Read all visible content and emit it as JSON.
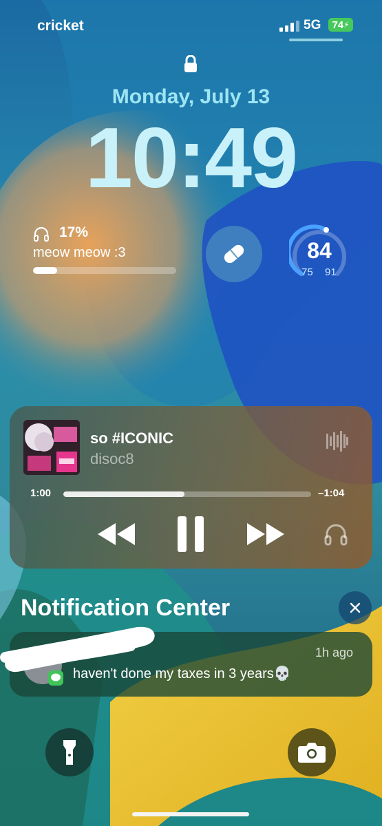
{
  "status_bar": {
    "carrier": "cricket",
    "network": "5G",
    "battery": "74"
  },
  "lock_screen": {
    "date": "Monday, July 13",
    "time": "10:49"
  },
  "widgets": {
    "device_battery": {
      "percent": "17%",
      "name": "meow meow :3",
      "level": 0.17
    },
    "gauge": {
      "value": "84",
      "low": "75",
      "high": "91"
    },
    "pill_icon": "pill-icon"
  },
  "now_playing": {
    "title": "so #ICONIC",
    "artist": "disoc8",
    "elapsed": "1:00",
    "remaining": "–1:04",
    "progress": 0.49
  },
  "notification_center": {
    "title": "Notification Center",
    "notifications": [
      {
        "time": "1h ago",
        "body": "haven't done my taxes in 3 years💀"
      }
    ]
  },
  "colors": {
    "battery_green": "#46c95c",
    "date_text": "#9ee5f3"
  },
  "icons": [
    "lock-icon",
    "headphones-icon",
    "pill-icon",
    "waveform-icon",
    "rewind-icon",
    "pause-icon",
    "fast-forward-icon",
    "airplay-headphones-icon",
    "close-icon",
    "flashlight-icon",
    "camera-icon",
    "messages-icon"
  ]
}
